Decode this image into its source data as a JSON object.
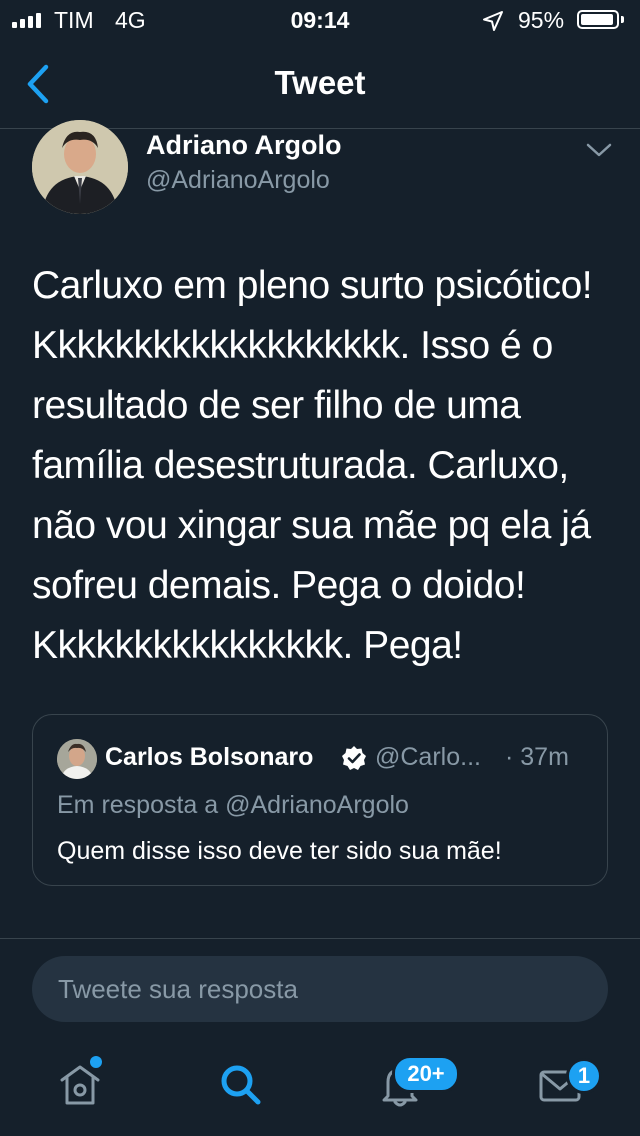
{
  "status_bar": {
    "carrier": "TIM",
    "network": "4G",
    "time": "09:14",
    "battery": "95%",
    "battery_level": 0.95
  },
  "nav": {
    "back_icon": "chevron-left-icon",
    "title": "Tweet"
  },
  "tweet": {
    "author_name": "Adriano Argolo",
    "author_handle": "@AdrianoArgolo",
    "text": "Carluxo em pleno surto psicótico!\nKkkkkkkkkkkkkkkkkkk. Isso é o\nresultado de ser filho de uma\nfamília desestruturada. Carluxo,\nnão vou xingar sua mãe pq ela já\nsofreu demais. Pega o doido!\nKkkkkkkkkkkkkkkk. Pega!"
  },
  "quoted_tweet": {
    "author_name": "Carlos Bolsonaro",
    "author_handle": "@Carlo...",
    "time": "· 37m",
    "reply_to": "Em resposta a @AdrianoArgolo",
    "text": "Quem disse isso deve ter sido sua mãe!"
  },
  "reply": {
    "placeholder": "Tweete sua resposta"
  },
  "tab_bar": {
    "home_icon": "home-icon",
    "search_icon": "search-icon",
    "notifications_icon": "bell-icon",
    "notifications_badge": "20+",
    "messages_icon": "mail-icon",
    "messages_badge": "1"
  },
  "colors": {
    "background": "#15202b",
    "accent": "#1da1f2",
    "secondary_text": "#8899a6",
    "border": "#38444d"
  }
}
